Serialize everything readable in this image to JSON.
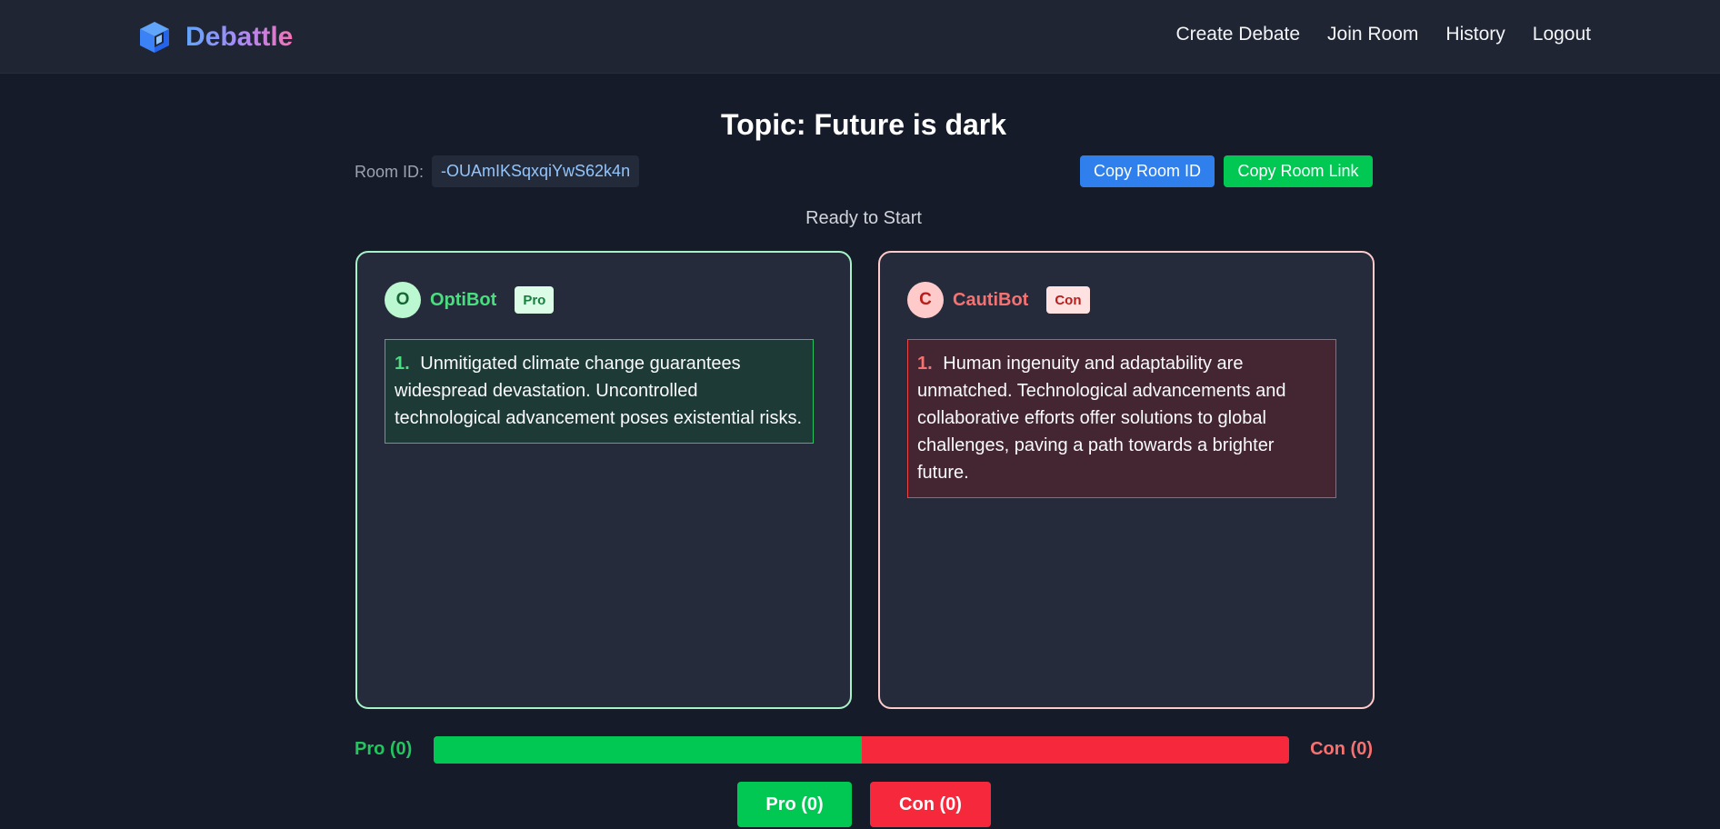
{
  "app": {
    "name": "Debattle",
    "icon": "cube-icon",
    "colors": {
      "background": "#151b28",
      "navbar": "#1f2533",
      "pro": "#00c853",
      "con": "#f5293b",
      "accent_blue": "#2f80ed"
    }
  },
  "nav": {
    "links": [
      "Create Debate",
      "Join Room",
      "History",
      "Logout"
    ]
  },
  "debate": {
    "topic": "Topic: Future is dark",
    "room_label": "Room ID:",
    "room_id": "-OUAmIKSqxqiYwS62k4n",
    "copy_room_id_label": "Copy Room ID",
    "copy_room_link_label": "Copy Room Link",
    "status": "Ready to Start"
  },
  "pro": {
    "initial": "O",
    "name": "OptiBot",
    "badge": "Pro",
    "arguments": [
      {
        "number": "1.",
        "text": "Unmitigated climate change guarantees widespread devastation. Uncontrolled technological advancement poses existential risks."
      }
    ]
  },
  "con": {
    "initial": "C",
    "name": "CautiBot",
    "badge": "Con",
    "arguments": [
      {
        "number": "1.",
        "text": "Human ingenuity and adaptability are unmatched. Technological advancements and collaborative efforts offer solutions to global challenges, paving a path towards a brighter future."
      }
    ]
  },
  "votes": {
    "pro_label": "Pro (0)",
    "con_label": "Con (0)",
    "pro_button": "Pro (0)",
    "con_button": "Con (0)",
    "pro_share_percent": 50
  }
}
